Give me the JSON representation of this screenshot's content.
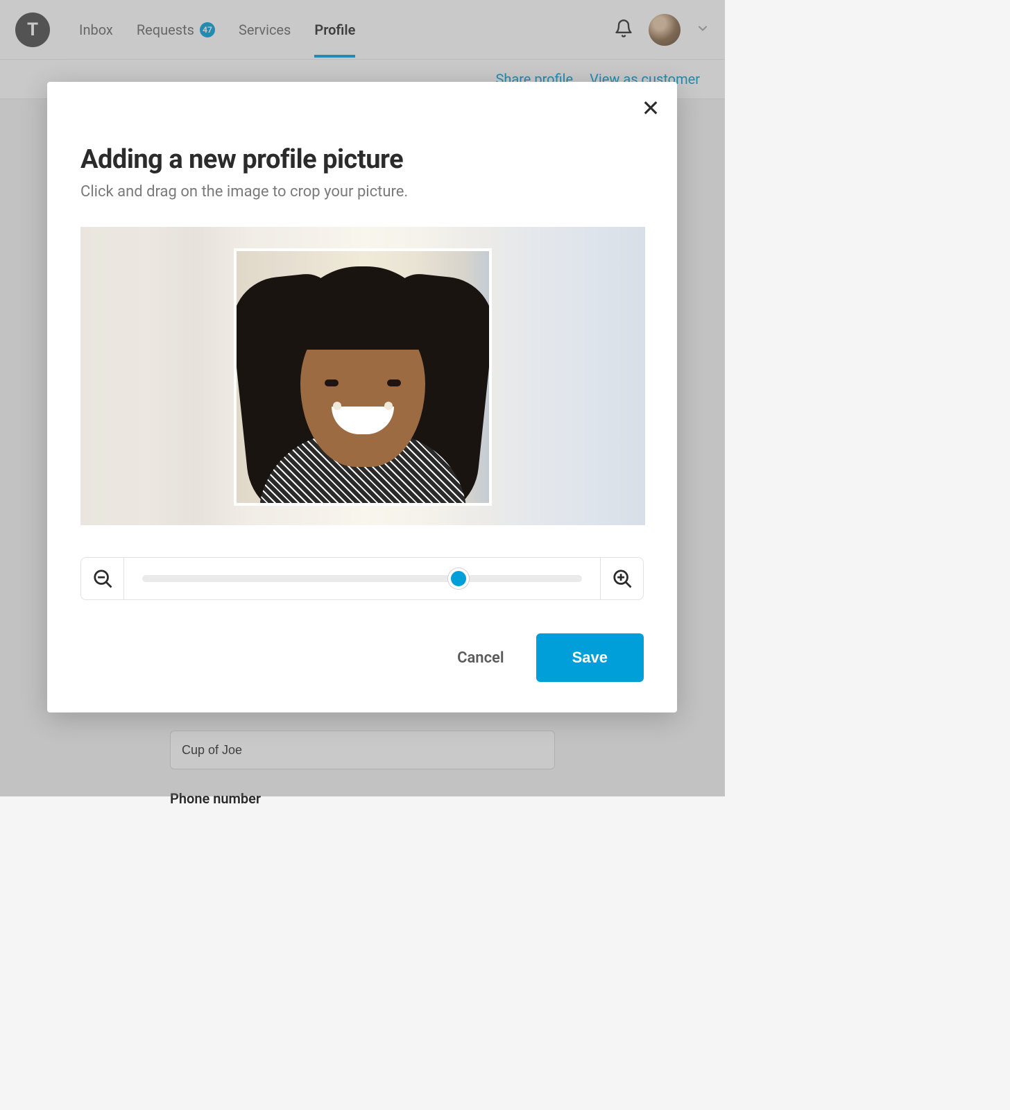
{
  "brand_letter": "T",
  "nav": {
    "inbox": "Inbox",
    "requests": "Requests",
    "requests_badge": "47",
    "services": "Services",
    "profile": "Profile"
  },
  "sublinks": {
    "share": "Share profile",
    "view_as": "View as customer"
  },
  "bg_form": {
    "field_value_partial": "Cup of Joe",
    "phone_label": "Phone number"
  },
  "modal": {
    "title": "Adding a new profile picture",
    "subtitle": "Click and drag on the image to crop your picture.",
    "cancel": "Cancel",
    "save": "Save",
    "zoom_percent": 72
  },
  "colors": {
    "accent": "#009fd9"
  }
}
